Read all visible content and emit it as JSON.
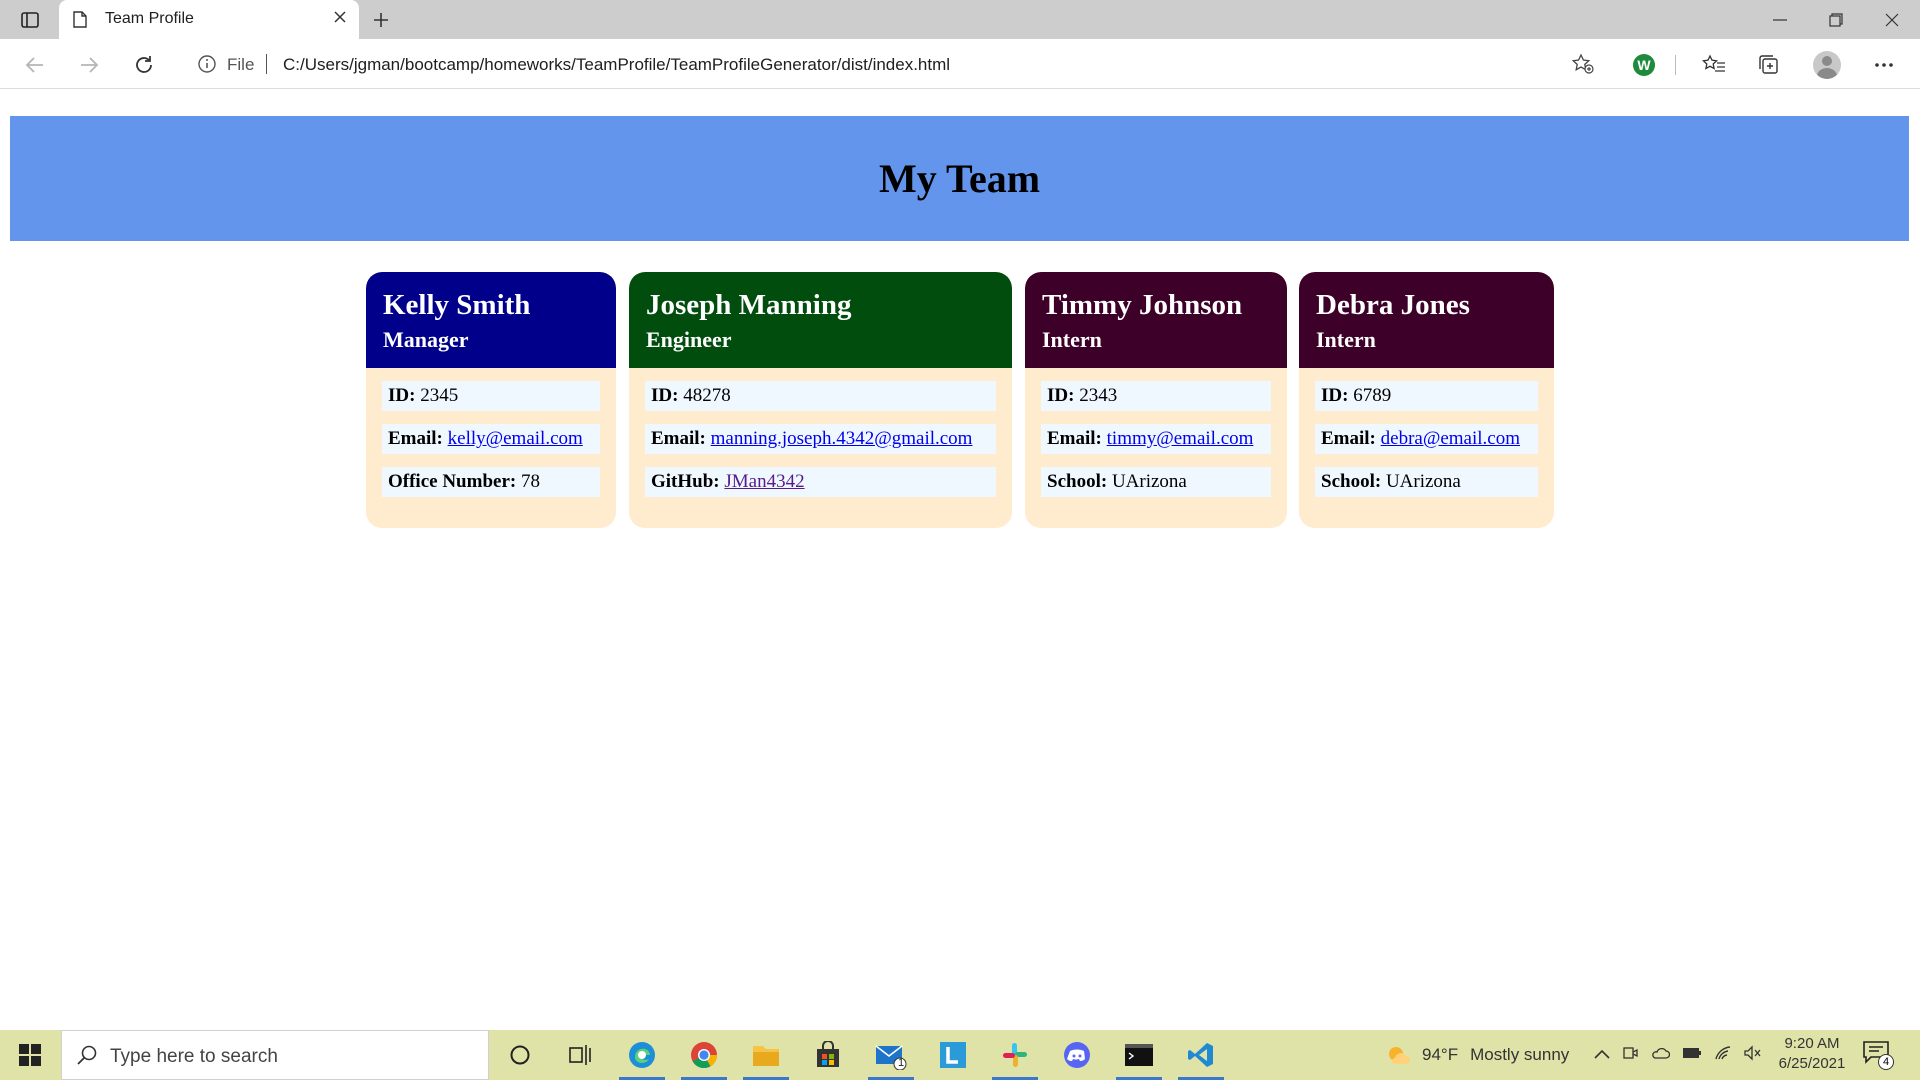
{
  "browser": {
    "tab_title": "Team Profile",
    "address_scheme": "File",
    "address_url": "C:/Users/jgman/bootcamp/homeworks/TeamProfile/TeamProfileGenerator/dist/index.html",
    "extension_letter": "W"
  },
  "page": {
    "heading": "My Team",
    "cards": [
      {
        "name": "Kelly Smith",
        "role": "Manager",
        "header_color": "#00008b",
        "rows": [
          {
            "label": "ID:",
            "value": "2345"
          },
          {
            "label": "Email:",
            "value": "kelly@email.com"
          },
          {
            "label": "Office Number:",
            "value": "78"
          }
        ]
      },
      {
        "name": "Joseph Manning",
        "role": "Engineer",
        "header_color": "#004d0d",
        "rows": [
          {
            "label": "ID:",
            "value": "48278"
          },
          {
            "label": "Email:",
            "value": "manning.joseph.4342@gmail.com"
          },
          {
            "label": "GitHub:",
            "value": "JMan4342"
          }
        ]
      },
      {
        "name": "Timmy Johnson",
        "role": "Intern",
        "header_color": "#3d0028",
        "rows": [
          {
            "label": "ID:",
            "value": "2343"
          },
          {
            "label": "Email:",
            "value": "timmy@email.com"
          },
          {
            "label": "School:",
            "value": "UArizona"
          }
        ]
      },
      {
        "name": "Debra Jones",
        "role": "Intern",
        "header_color": "#3d0028",
        "rows": [
          {
            "label": "ID:",
            "value": "6789"
          },
          {
            "label": "Email:",
            "value": "debra@email.com"
          },
          {
            "label": "School:",
            "value": "UArizona"
          }
        ]
      }
    ],
    "colors": {
      "jumbotron": "#6495ed",
      "card_body": "#ffebcd",
      "row_background": "#f0f8ff"
    }
  },
  "taskbar": {
    "search_placeholder": "Type here to search",
    "mail_badge": "1",
    "weather_temp": "94°F",
    "weather_desc": "Mostly sunny",
    "time": "9:20 AM",
    "date": "6/25/2021",
    "notification_count": "4"
  }
}
